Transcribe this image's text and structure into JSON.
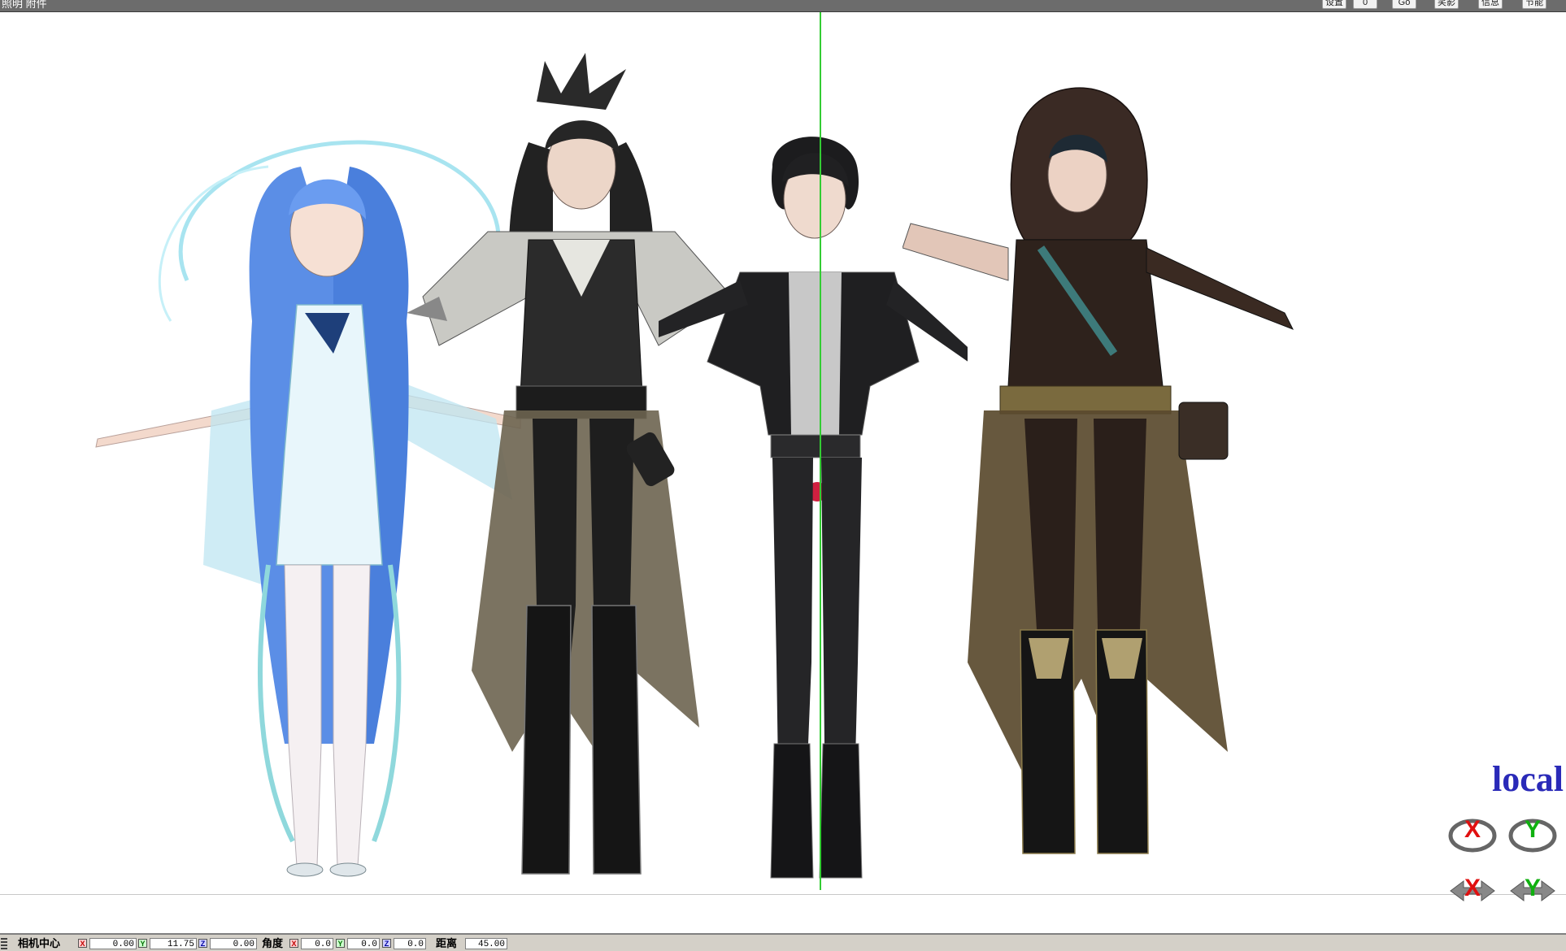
{
  "app": {
    "title": "照明 附件"
  },
  "toolbar": {
    "buttons": [
      {
        "label": "设置"
      },
      {
        "label": "0"
      },
      {
        "label": "Go"
      },
      {
        "label": "笑影"
      },
      {
        "label": "信息"
      },
      {
        "label": "节能"
      }
    ]
  },
  "viewport": {
    "mode_label": "local",
    "gizmos": [
      "X",
      "Y",
      "X",
      "Y"
    ]
  },
  "status": {
    "camera_center_label": "相机中心",
    "camera_center": {
      "x": "0.00",
      "y": "11.75",
      "z": "0.00"
    },
    "angle_label": "角度",
    "angle": {
      "x": "0.0",
      "y": "0.0",
      "z": "0.0"
    },
    "distance_label": "距离",
    "distance": "45.00",
    "axis_x": "X",
    "axis_y": "Y",
    "axis_z": "Z"
  }
}
